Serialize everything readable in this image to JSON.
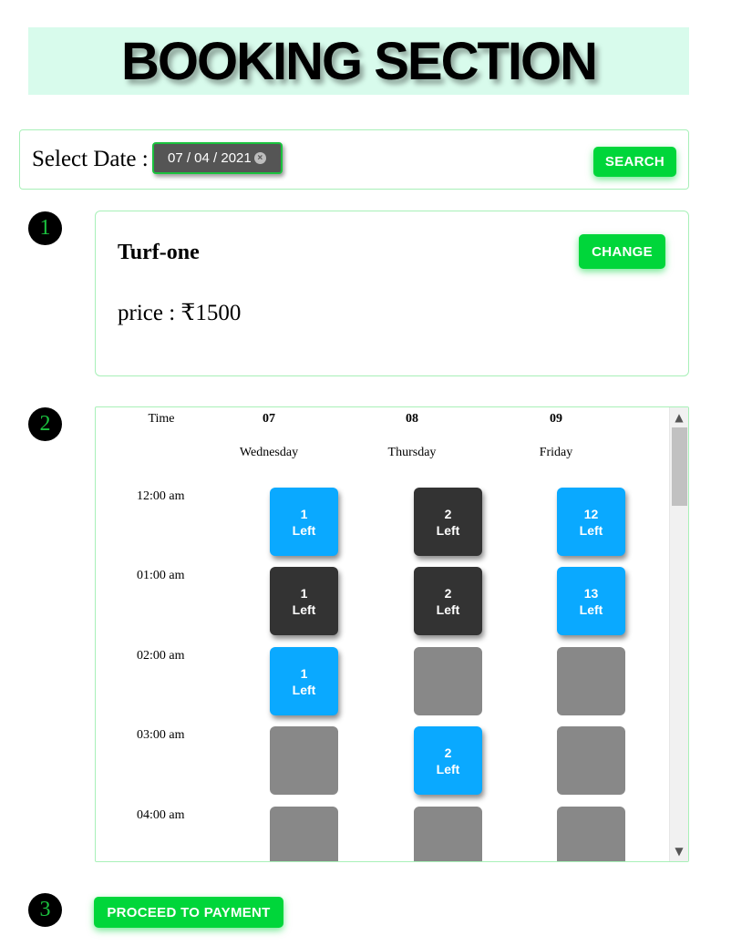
{
  "header": {
    "title": "BOOKING SECTION"
  },
  "date_panel": {
    "label": "Select Date :",
    "date_value": "07 / 04 / 2021",
    "clear_icon": "clear-circle-icon",
    "search_label": "SEARCH"
  },
  "steps": [
    "1",
    "2",
    "3"
  ],
  "turf": {
    "name": "Turf-one",
    "price": "price : ₹1500",
    "change_label": "CHANGE"
  },
  "schedule": {
    "time_header": "Time",
    "days": [
      {
        "date": "07",
        "weekday": "Wednesday"
      },
      {
        "date": "08",
        "weekday": "Thursday"
      },
      {
        "date": "09",
        "weekday": "Friday"
      }
    ],
    "rows": [
      {
        "time": "12:00 am",
        "slots": [
          {
            "state": "available",
            "count": "1",
            "label": "Left"
          },
          {
            "state": "selected",
            "count": "2",
            "label": "Left"
          },
          {
            "state": "available",
            "count": "12",
            "label": "Left"
          }
        ]
      },
      {
        "time": "01:00 am",
        "slots": [
          {
            "state": "selected",
            "count": "1",
            "label": "Left"
          },
          {
            "state": "selected",
            "count": "2",
            "label": "Left"
          },
          {
            "state": "available",
            "count": "13",
            "label": "Left"
          }
        ]
      },
      {
        "time": "02:00 am",
        "slots": [
          {
            "state": "available",
            "count": "1",
            "label": "Left"
          },
          {
            "state": "unavailable",
            "count": "",
            "label": ""
          },
          {
            "state": "unavailable",
            "count": "",
            "label": ""
          }
        ]
      },
      {
        "time": "03:00 am",
        "slots": [
          {
            "state": "unavailable",
            "count": "",
            "label": ""
          },
          {
            "state": "available",
            "count": "2",
            "label": "Left"
          },
          {
            "state": "unavailable",
            "count": "",
            "label": ""
          }
        ]
      },
      {
        "time": "04:00 am",
        "slots": [
          {
            "state": "unavailable",
            "count": "",
            "label": ""
          },
          {
            "state": "unavailable",
            "count": "",
            "label": ""
          },
          {
            "state": "unavailable",
            "count": "",
            "label": ""
          }
        ]
      }
    ]
  },
  "payment": {
    "proceed_label": "PROCEED TO PAYMENT"
  },
  "colors": {
    "accent_green": "#00d63a",
    "slot_available": "#0aa9ff",
    "slot_selected": "#333333",
    "slot_unavailable": "#888888",
    "banner_bg": "#d8fbec"
  }
}
